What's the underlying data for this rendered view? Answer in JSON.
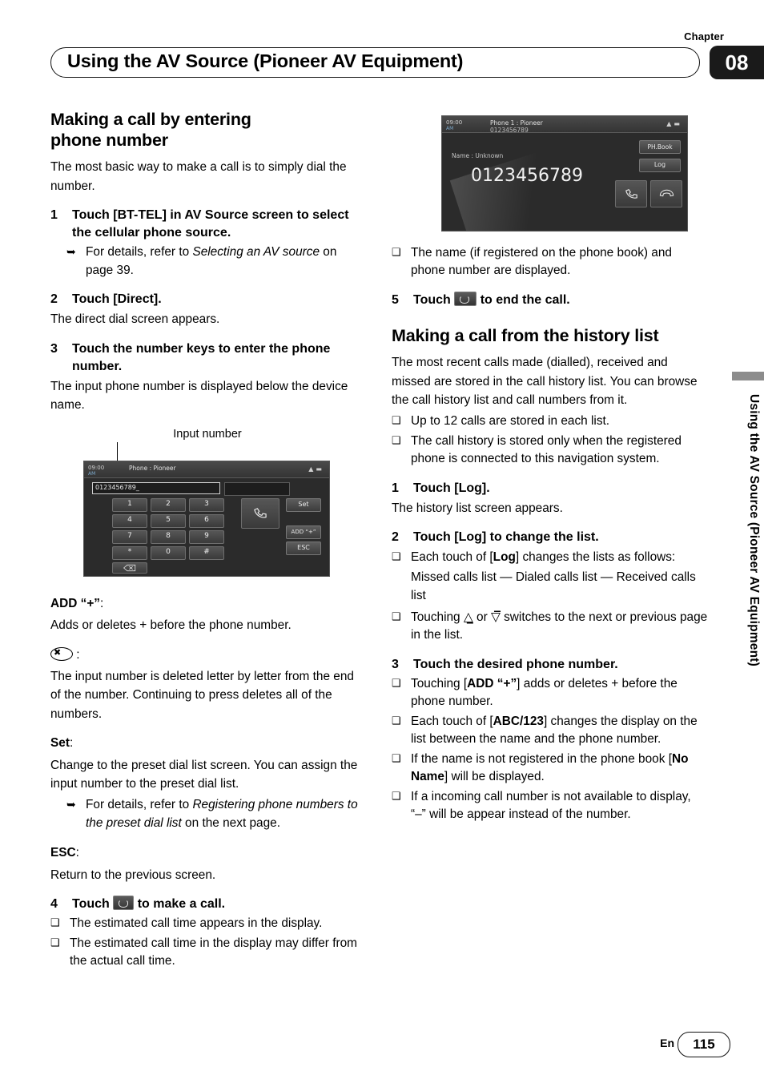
{
  "header": {
    "chapter_word": "Chapter",
    "chapter_number": "08",
    "title": "Using the AV Source (Pioneer AV Equipment)"
  },
  "side_tab": {
    "text": "Using the AV Source (Pioneer AV Equipment)"
  },
  "left": {
    "h1": "Making a call by entering",
    "h1b": "phone number",
    "intro": "The most basic way to make a call is to simply dial the number.",
    "step1_num": "1",
    "step1": "Touch [BT-TEL] in AV Source screen to select the cellular phone source.",
    "step1_ref_pre": "For details, refer to ",
    "step1_ref_ital": "Selecting an AV source",
    "step1_ref_post": " on page 39.",
    "step2_num": "2",
    "step2": "Touch [Direct].",
    "step2_body": "The direct dial screen appears.",
    "step3_num": "3",
    "step3": "Touch the number keys to enter the phone number.",
    "step3_body": "The input phone number is displayed below the device name.",
    "figure_caption": "Input number",
    "add_term": "ADD “+”",
    "add_colon": ":",
    "add_body": "Adds or deletes + before the phone number.",
    "del_colon": ":",
    "del_body": "The input number is deleted letter by letter from the end of the number. Continuing to press deletes all of the numbers.",
    "set_term": "Set",
    "set_colon": ":",
    "set_body": "Change to the preset dial list screen. You can assign the input number to the preset dial list.",
    "set_ref_pre": "For details, refer to ",
    "set_ref_ital": "Registering phone numbers to the preset dial list",
    "set_ref_post": " on the next page.",
    "esc_term": "ESC",
    "esc_colon": ":",
    "esc_body": "Return to the previous screen.",
    "step4_num": "4",
    "step4_pre": "Touch ",
    "step4_post": " to make a call.",
    "step4_note1": "The estimated call time appears in the display.",
    "step4_note2": "The estimated call time in the display may differ from the actual call time."
  },
  "right": {
    "fig_note": "The name (if registered on the phone book) and phone number are displayed.",
    "step5_num": "5",
    "step5_pre": "Touch ",
    "step5_post": " to end the call.",
    "h2": "Making a call from the history list",
    "intro": "The most recent calls made (dialled), received and missed are stored in the call history list. You can browse the call history list and call numbers from it.",
    "note1": "Up to 12 calls are stored in each list.",
    "note2": "The call history is stored only when the registered phone is connected to this navigation system.",
    "step1_num": "1",
    "step1": "Touch [Log].",
    "step1_body": "The history list screen appears.",
    "step2_num": "2",
    "step2": "Touch [Log] to change the list.",
    "step2_note1_pre": "Each touch of [",
    "step2_note1_bold": "Log",
    "step2_note1_post": "] changes the lists as follows:",
    "step2_note1_sub": "Missed calls list — Dialed calls list — Received calls list",
    "step2_note2_pre": "Touching ",
    "step2_note2_mid": " or ",
    "step2_note2_post": " switches to the next or previous page in the list.",
    "step3_num": "3",
    "step3": "Touch the desired phone number.",
    "step3_note1_pre": "Touching [",
    "step3_note1_bold": "ADD “+”",
    "step3_note1_post": "] adds or deletes + before the phone number.",
    "step3_note2_pre": "Each touch of [",
    "step3_note2_bold": "ABC/123",
    "step3_note2_post": "] changes the display on the list between the name and the phone number.",
    "step3_note3_pre": "If the name is not registered in the phone book [",
    "step3_note3_bold": "No Name",
    "step3_note3_post": "] will be displayed.",
    "step3_note4": "If a incoming call number is not available to display, “–” will be appear instead of the number."
  },
  "device_top": {
    "clock": "09:00",
    "ampm": "AM",
    "source": "Phone 1 : Pioneer",
    "number": "0123456789",
    "name_label": "Name : Unknown",
    "big_number": "0123456789",
    "btn_phbook": "PH.Book",
    "btn_log": "Log"
  },
  "device_bottom": {
    "clock": "09:00",
    "ampm": "AM",
    "source": "Phone : Pioneer",
    "input_value": "0123456789_",
    "keys": [
      "1",
      "2",
      "3",
      "4",
      "5",
      "6",
      "7",
      "8",
      "9",
      "*",
      "0",
      "#"
    ],
    "btn_set": "Set",
    "btn_add": "ADD “+”",
    "btn_esc": "ESC"
  },
  "footer": {
    "lang": "En",
    "page": "115"
  }
}
